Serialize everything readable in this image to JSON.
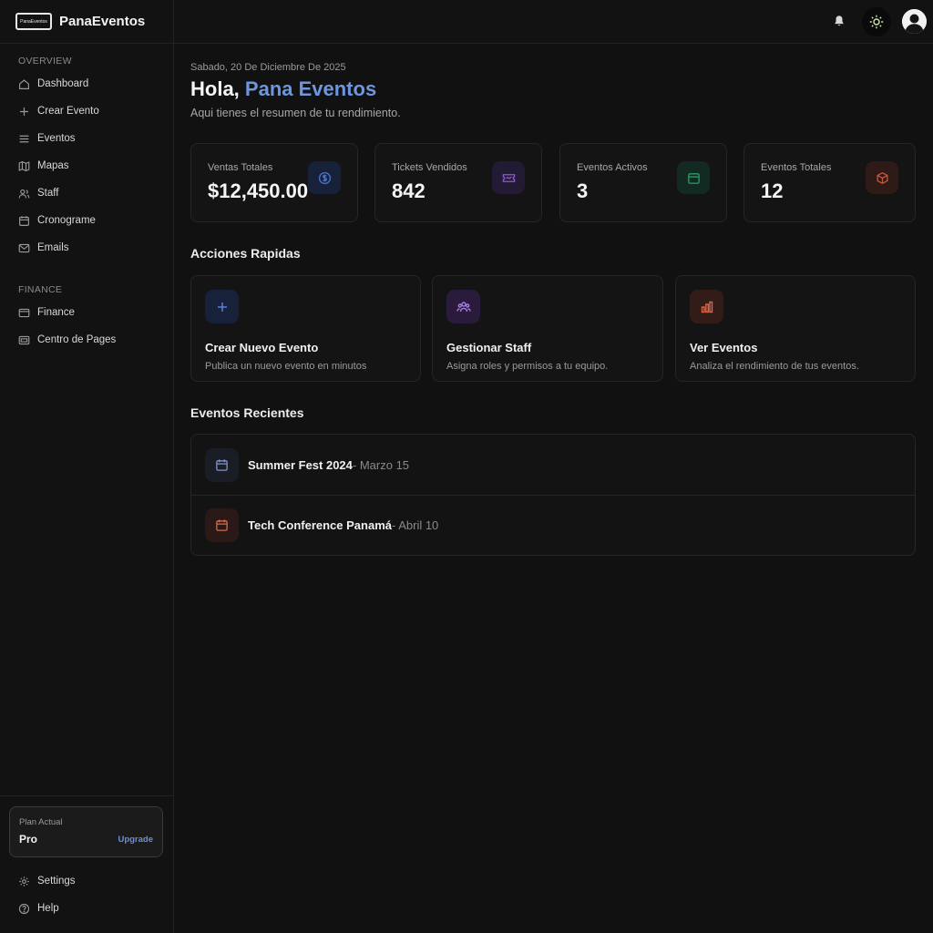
{
  "brand": {
    "name": "PanaEventos",
    "logo_text": "PanaEventos"
  },
  "sidebar": {
    "overview_label": "OVERVIEW",
    "overview_items": [
      {
        "label": "Dashboard",
        "icon": "home-icon"
      },
      {
        "label": "Crear Evento",
        "icon": "plus-icon"
      },
      {
        "label": "Eventos",
        "icon": "list-icon"
      },
      {
        "label": "Mapas",
        "icon": "map-icon"
      },
      {
        "label": "Staff",
        "icon": "users-icon"
      },
      {
        "label": "Cronograme",
        "icon": "calendar-icon"
      },
      {
        "label": "Emails",
        "icon": "mail-icon"
      }
    ],
    "finance_label": "FINANCE",
    "finance_items": [
      {
        "label": "Finance",
        "icon": "wallet-icon"
      },
      {
        "label": "Centro de Pages",
        "icon": "credit-card-icon"
      }
    ],
    "plan": {
      "label": "Plan Actual",
      "name": "Pro",
      "upgrade": "Upgrade"
    },
    "footer_items": [
      {
        "label": "Settings",
        "icon": "gear-icon"
      },
      {
        "label": "Help",
        "icon": "help-icon"
      }
    ]
  },
  "header": {
    "date": "Sabado, 20 De Diciembre De 2025",
    "greeting_prefix": "Hola, ",
    "greeting_name": "Pana Eventos",
    "subtitle": "Aqui tienes el resumen de tu rendimiento."
  },
  "stats": [
    {
      "label": "Ventas Totales",
      "value": "$12,450.00",
      "icon": "dollar-icon",
      "color": "#4f73c9"
    },
    {
      "label": "Tickets Vendidos",
      "value": "842",
      "icon": "ticket-icon",
      "color": "#8a5cc9"
    },
    {
      "label": "Eventos Activos",
      "value": "3",
      "icon": "calendar-icon",
      "color": "#2f9a6a"
    },
    {
      "label": "Eventos Totales",
      "value": "12",
      "icon": "box-icon",
      "color": "#c9553b"
    }
  ],
  "quick_actions": {
    "title": "Acciones Rapidas",
    "items": [
      {
        "title": "Crear Nuevo Evento",
        "desc": "Publica un nuevo evento en minutos",
        "icon": "plus-icon",
        "color": "#5a7fd6"
      },
      {
        "title": "Gestionar Staff",
        "desc": "Asigna roles y permisos a tu equipo.",
        "icon": "users-icon",
        "color": "#a77ee0"
      },
      {
        "title": "Ver Eventos",
        "desc": "Analiza el rendimiento de tus eventos.",
        "icon": "bar-chart-icon",
        "color": "#d9674a"
      }
    ]
  },
  "recent": {
    "title": "Eventos Recientes",
    "items": [
      {
        "name": "Summer Fest 2024",
        "date": " - Marzo 15",
        "icon": "calendar-icon",
        "color": "#5a7fd6"
      },
      {
        "name": "Tech Conference Panamá",
        "date": " - Abril 10",
        "icon": "calendar-icon",
        "color": "#d9674a"
      }
    ]
  }
}
